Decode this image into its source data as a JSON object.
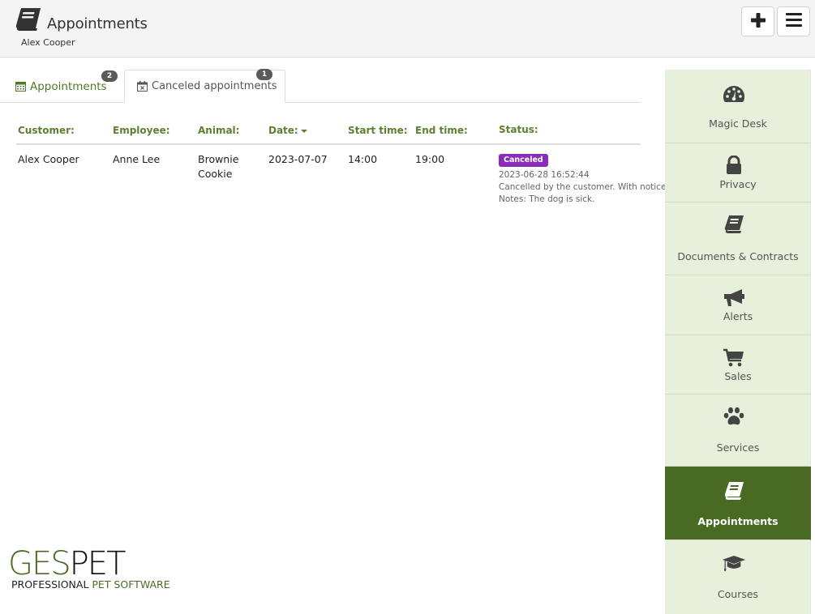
{
  "header": {
    "title": "Appointments",
    "subtitle": "Alex Cooper",
    "icon": "book-icon",
    "add_button_icon": "plus-icon",
    "menu_button_icon": "hamburger-menu-icon"
  },
  "tabs": [
    {
      "label": "Appointments",
      "icon": "calendar-icon",
      "badge": "2",
      "active": false
    },
    {
      "label": "Canceled appointments",
      "icon": "calendar-times-icon",
      "badge": "1",
      "active": true
    }
  ],
  "table": {
    "columns": [
      "Customer:",
      "Employee:",
      "Animal:",
      "Date:",
      "Start time:",
      "End time:",
      "Status:"
    ],
    "sorted_column": "Date:",
    "rows": [
      {
        "customer": "Alex Cooper",
        "employee": "Anne Lee",
        "animal": [
          "Brownie",
          "Cookie"
        ],
        "date": "2023-07-07",
        "start_time": "14:00",
        "end_time": "19:00",
        "status": {
          "badge": "Canceled",
          "badge_color": "#8a2cb8",
          "timestamp": "2023-06-28 16:52:44",
          "reason": "Cancelled by the customer. With notice",
          "notes": "Notes: The dog is sick."
        }
      }
    ]
  },
  "sidebar": {
    "items": [
      {
        "label": "Magic Desk",
        "icon": "dashboard-gauge-icon",
        "active": false
      },
      {
        "label": "Privacy",
        "icon": "lock-icon",
        "active": false
      },
      {
        "label": "Documents & Contracts",
        "icon": "book-icon",
        "active": false
      },
      {
        "label": "Alerts",
        "icon": "megaphone-icon",
        "active": false
      },
      {
        "label": "Sales",
        "icon": "shopping-cart-icon",
        "active": false
      },
      {
        "label": "Services",
        "icon": "paw-icon",
        "active": false
      },
      {
        "label": "Appointments",
        "icon": "book-icon",
        "active": true
      },
      {
        "label": "Courses",
        "icon": "graduation-cap-icon",
        "active": false
      }
    ]
  },
  "logo": {
    "part1": "GES",
    "part2": "PET",
    "tagline_part1": "PROFESSIONAL ",
    "tagline_part2": "PET SOFTWARE"
  },
  "colors": {
    "accent_green": "#486a22",
    "header_green_text": "#5e7f2f",
    "sidebar_bg": "#e6f0db",
    "canceled_badge": "#8a2cb8"
  }
}
